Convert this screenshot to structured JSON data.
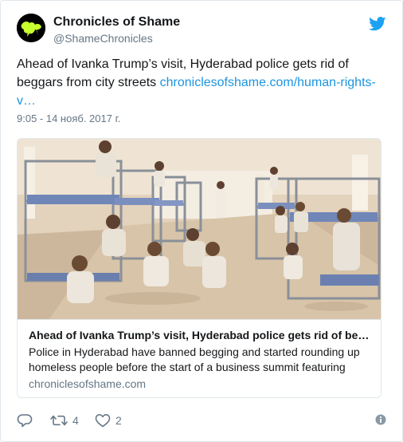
{
  "author": {
    "display_name": "Chronicles of Shame",
    "handle": "@ShameChronicles"
  },
  "tweet": {
    "text": "Ahead of Ivanka Trump’s visit, Hyderabad police gets rid of beggars from city streets ",
    "link_text": "chroniclesofshame.com/human-rights-v…",
    "timestamp": "9:05 - 14 нояб. 2017 г."
  },
  "card": {
    "title": "Ahead of Ivanka Trump’s visit, Hyderabad police gets rid of be…",
    "description": "Police in Hyderabad have banned begging and started rounding up homeless people before the start of a business summit featuring",
    "domain": "chroniclesofshame.com"
  },
  "actions": {
    "retweet_count": "4",
    "like_count": "2"
  },
  "icons": {
    "bird": "twitter-bird-icon",
    "reply": "reply-icon",
    "retweet": "retweet-icon",
    "like": "heart-icon",
    "info": "info-icon"
  },
  "colors": {
    "link": "#1b95e0",
    "secondary_text": "#657786",
    "border": "#e1e8ed"
  }
}
